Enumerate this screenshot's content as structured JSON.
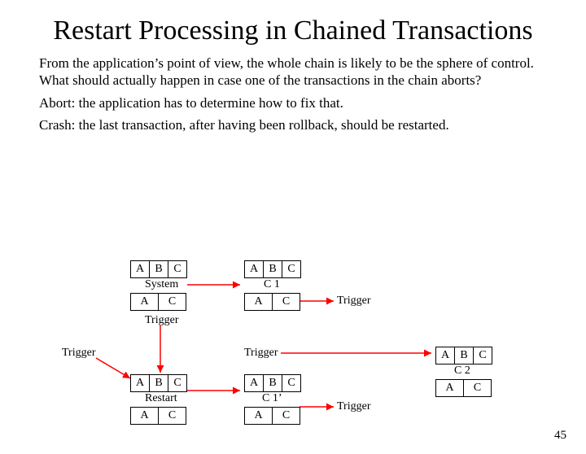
{
  "title": "Restart Processing in Chained Transactions",
  "para1": "From the application’s point of view, the whole chain is likely to be the sphere of control. What should actually happen in case one of the transactions in the chain aborts?",
  "para2": "Abort: the application has to determine how to fix that.",
  "para3": "Crash: the last transaction, after having been rollback, should be restarted.",
  "page_num": "45",
  "cells": {
    "A": "A",
    "B": "B",
    "C": "C"
  },
  "labels": {
    "system": "System",
    "trigger": "Trigger",
    "restart": "Restart",
    "c1": "C 1",
    "c1p": "C 1’",
    "c2": "C 2"
  }
}
